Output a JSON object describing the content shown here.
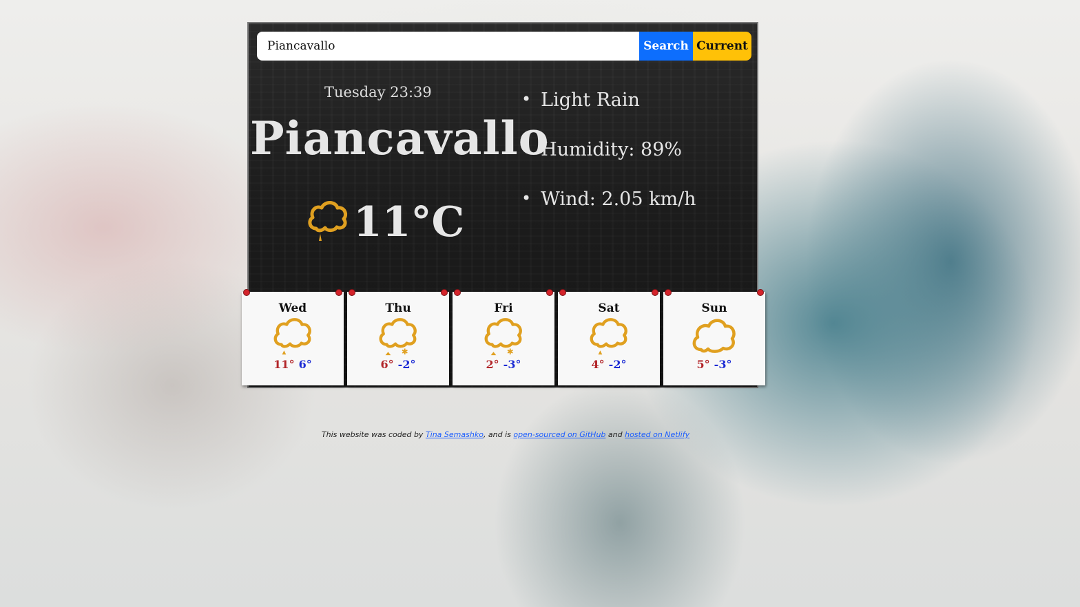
{
  "search": {
    "value": "Piancavallo",
    "search_label": "Search",
    "current_label": "Current"
  },
  "current": {
    "date": "Tuesday 23:39",
    "city": "Piancavallo",
    "temperature": "11°C",
    "icon": "cloud-rain-icon",
    "description": "Light Rain",
    "humidity": "Humidity: 89%",
    "wind": "Wind: 2.05 km/h"
  },
  "forecast": [
    {
      "day": "Wed",
      "high": "11°",
      "low": "6°",
      "icon": "cloud-rain-icon"
    },
    {
      "day": "Thu",
      "high": "6°",
      "low": "-2°",
      "icon": "cloud-snow-icon"
    },
    {
      "day": "Fri",
      "high": "2°",
      "low": "-3°",
      "icon": "cloud-snow-icon"
    },
    {
      "day": "Sat",
      "high": "4°",
      "low": "-2°",
      "icon": "cloud-rain-icon"
    },
    {
      "day": "Sun",
      "high": "5°",
      "low": "-3°",
      "icon": "cloud-icon"
    }
  ],
  "footer": {
    "text1": "This website was coded by ",
    "author": "Tina Semashko",
    "text2": ", and is ",
    "github": "open-sourced on GitHub",
    "text3": " and ",
    "netlify": "hosted on Netlify"
  },
  "colors": {
    "icon": "#e0a020",
    "high": "#b2262a",
    "low": "#1c2bd4",
    "search_button": "#0d6efd",
    "current_button": "#ffc107"
  }
}
